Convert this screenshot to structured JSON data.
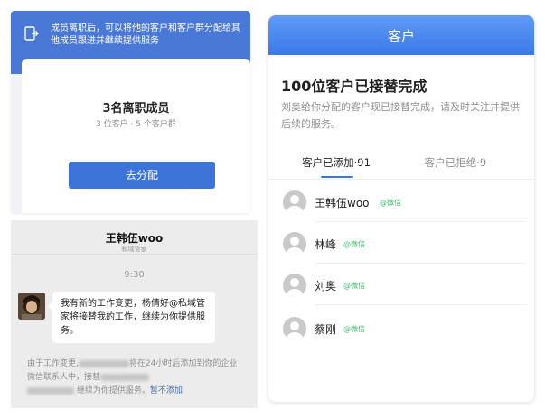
{
  "departed_panel": {
    "notice_text": "成员离职后，可以将他的客户和客户群分配给其他成员跟进并继续提供服务",
    "title": "3名离职成员",
    "subtitle": "3 位客户 · 5 个客户群",
    "assign_button": "去分配"
  },
  "chat_panel": {
    "contact_name": "王韩伍woo",
    "contact_role": "私域管家",
    "time": "9:30",
    "message": "我有新的工作变更，杨倩好@私域管家将接替我的工作，继续为你提供服务。",
    "system_text_1": "由于工作变更,",
    "system_text_2": "将在24小时后添加到你的企业微信联系人中，接替",
    "system_text_3": "继续为你提供服务。",
    "system_link": "暂不添加"
  },
  "handover_panel": {
    "header_title": "客户",
    "title": "100位客户已接替完成",
    "description": "刘奥给你分配的客户现已接替完成，请及时关注并提供后续的服务。",
    "tabs": [
      {
        "label": "客户已添加·91",
        "active": true
      },
      {
        "label": "客户已拒绝·9",
        "active": false
      }
    ],
    "customers": [
      {
        "name": "王韩伍woo",
        "tag": "@微信"
      },
      {
        "name": "林峰",
        "tag": "@微信"
      },
      {
        "name": "刘奥",
        "tag": "@微信"
      },
      {
        "name": "蔡刚",
        "tag": "@微信"
      }
    ]
  },
  "colors": {
    "accent_blue": "#3d74d8",
    "header_blue": "#4a78d6",
    "wechat_green": "#3ec06b",
    "muted_text": "#8f8f8f"
  }
}
